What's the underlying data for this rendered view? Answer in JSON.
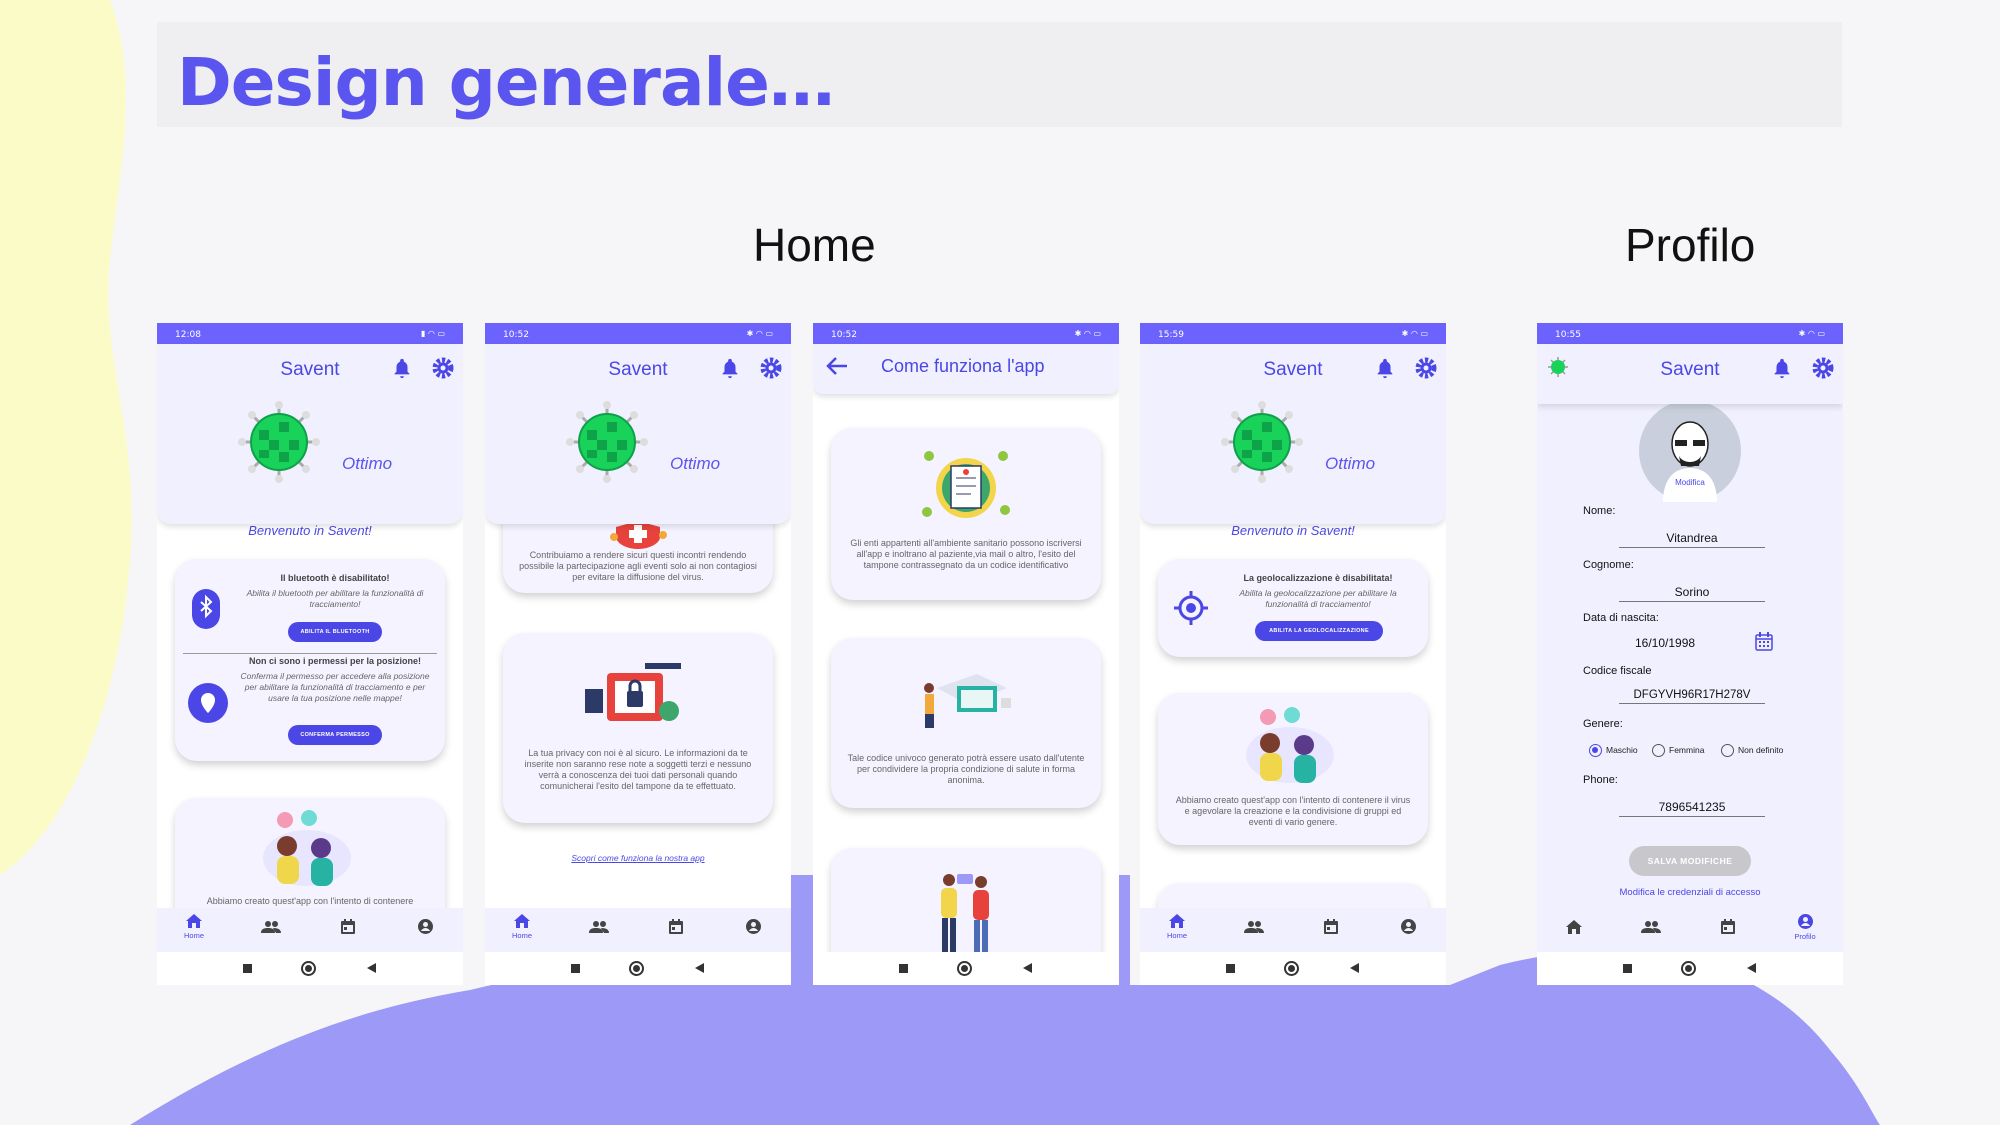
{
  "slide": {
    "title": "Design generale…",
    "home_label": "Home",
    "profile_label": "Profilo"
  },
  "colors": {
    "accent": "#4b47e6",
    "statusbar": "#6c63ff",
    "header_bg": "#f1f0ff",
    "blob_yellow": "#fbfbc8",
    "blob_purple": "#9c99f7",
    "virus_green": "#18d25a"
  },
  "phone1": {
    "time": "12:08",
    "app_name": "Savent",
    "status": "Ottimo",
    "welcome": "Benvenuto in Savent!",
    "bt_title": "Il bluetooth è disabilitato!",
    "bt_text": "Abilita il bluetooth per abilitare la funzionalità di tracciamento!",
    "bt_button": "ABILITA IL BLUETOOTH",
    "perm_title": "Non ci sono i permessi per la posizione!",
    "perm_text": "Conferma il permesso per accedere alla posizione per abilitare la funzionalità di tracciamento e per usare la tua posizione nelle mappe!",
    "perm_button": "CONFERMA PERMESSO",
    "card2_text": "Abbiamo creato quest'app con l'intento di contenere",
    "nav_home": "Home"
  },
  "phone2": {
    "time": "10:52",
    "app_name": "Savent",
    "status": "Ottimo",
    "card1_text": "Contribuiamo a rendere sicuri questi incontri rendendo possibile la partecipazione agli eventi solo ai non contagiosi per evitare la diffusione del virus.",
    "card2_text": "La tua privacy con noi è al sicuro. Le informazioni da te inserite non saranno rese note a soggetti terzi e nessuno verrà a conoscenza dei tuoi dati personali quando comunicherai l'esito del tampone da te effettuato.",
    "link": "Scopri come funziona la nostra app",
    "nav_home": "Home"
  },
  "phone3": {
    "time": "10:52",
    "title": "Come funziona l'app",
    "card1_text": "Gli enti appartenti all'ambiente sanitario possono iscriversi all'app e inoltrano al paziente,via mail o altro, l'esito del tampone contrassegnato da un codice identificativo",
    "card2_text": "Tale codice univoco generato potrà essere usato dall'utente per condividere la propria condizione di salute in forma anonima."
  },
  "phone4": {
    "time": "15:59",
    "app_name": "Savent",
    "status": "Ottimo",
    "welcome": "Benvenuto in Savent!",
    "geo_title": "La geolocalizzazione è disabilitata!",
    "geo_text": "Abilita la geolocalizzazione per abilitare la funzionalità di tracciamento!",
    "geo_button": "ABILITA LA GEOLOCALIZZAZIONE",
    "card2_text": "Abbiamo creato quest'app con l'intento di contenere il virus e agevolare la creazione e la condivisione di gruppi ed eventi di vario genere.",
    "nav_home": "Home"
  },
  "phone5": {
    "time": "10:55",
    "app_name": "Savent",
    "edit": "Modifica",
    "name_label": "Nome:",
    "name": "Vitandrea",
    "surname_label": "Cognome:",
    "surname": "Sorino",
    "birth_label": "Data di nascita:",
    "birth": "16/10/1998",
    "cf_label": "Codice fiscale",
    "cf": "DFGYVH96R17H278V",
    "gender_label": "Genere:",
    "g1": "Maschio",
    "g2": "Femmina",
    "g3": "Non definito",
    "phone_label": "Phone:",
    "phone": "7896541235",
    "save": "SALVA MODIFICHE",
    "cred_link": "Modifica le credenziali di accesso",
    "nav_profile": "Profilo"
  }
}
